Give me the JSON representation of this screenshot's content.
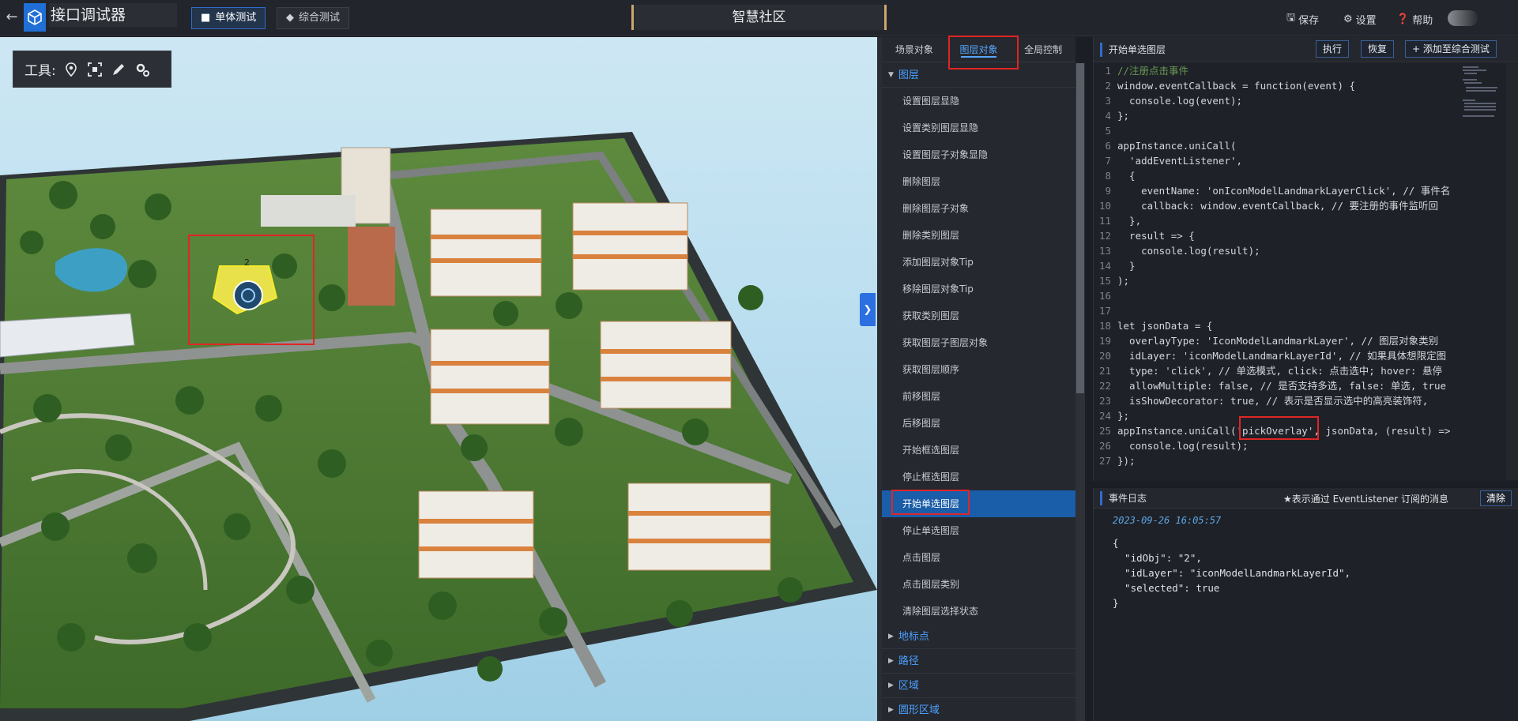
{
  "header": {
    "app_title": "接口调试器",
    "mode_single": "单体测试",
    "mode_combined": "综合测试",
    "scene_title": "智慧社区",
    "save": "保存",
    "settings": "设置",
    "help": "帮助"
  },
  "viewport": {
    "tools_label": "工具:",
    "marker_label": "2",
    "icons": [
      "location-pin-icon",
      "frame-select-icon",
      "pen-icon",
      "gears-icon"
    ]
  },
  "api_tabs": [
    "场景对象",
    "图层对象",
    "全局控制"
  ],
  "api_groups": {
    "layer": "图层",
    "landmark": "地标点",
    "path": "路径",
    "region": "区域",
    "circle_region": "圆形区域"
  },
  "api_items": [
    "设置图层显隐",
    "设置类别图层显隐",
    "设置图层子对象显隐",
    "删除图层",
    "删除图层子对象",
    "删除类别图层",
    "添加图层对象Tip",
    "移除图层对象Tip",
    "获取类别图层",
    "获取图层子图层对象",
    "获取图层顺序",
    "前移图层",
    "后移图层",
    "开始框选图层",
    "停止框选图层",
    "开始单选图层",
    "停止单选图层",
    "点击图层",
    "点击图层类别",
    "清除图层选择状态"
  ],
  "code_panel": {
    "title": "开始单选图层",
    "run": "执行",
    "reset": "恢复",
    "add": "添加至综合测试",
    "lines": [
      "//注册点击事件",
      "window.eventCallback = function(event) {",
      "  console.log(event);",
      "};",
      "",
      "appInstance.uniCall(",
      "  'addEventListener',",
      "  {",
      "    eventName: 'onIconModelLandmarkLayerClick', // 事件名",
      "    callback: window.eventCallback, // 要注册的事件监听回",
      "  },",
      "  result => {",
      "    console.log(result);",
      "  }",
      ");",
      "",
      "",
      "let jsonData = {",
      "  overlayType: 'IconModelLandmarkLayer', // 图层对象类别",
      "  idLayer: 'iconModelLandmarkLayerId', // 如果具体想限定图",
      "  type: 'click', // 单选模式, click: 点击选中; hover: 悬停",
      "  allowMultiple: false, // 是否支持多选, false: 单选, true",
      "  isShowDecorator: true, // 表示是否显示选中的高亮装饰符,",
      "};",
      "appInstance.uniCall('pickOverlay', jsonData, (result) =>",
      "  console.log(result);",
      "});"
    ]
  },
  "event_log": {
    "title": "事件日志",
    "note": "★表示通过 EventListener 订阅的消息",
    "clear": "清除",
    "time": "2023-09-26 16:05:57",
    "json": "{\n  \"idObj\": \"2\",\n  \"idLayer\": \"iconModelLandmarkLayerId\",\n  \"selected\": true\n}"
  },
  "colors": {
    "accent": "#58a6ff",
    "selected_bg": "#1a5da8",
    "highlight_red": "#e02525"
  }
}
